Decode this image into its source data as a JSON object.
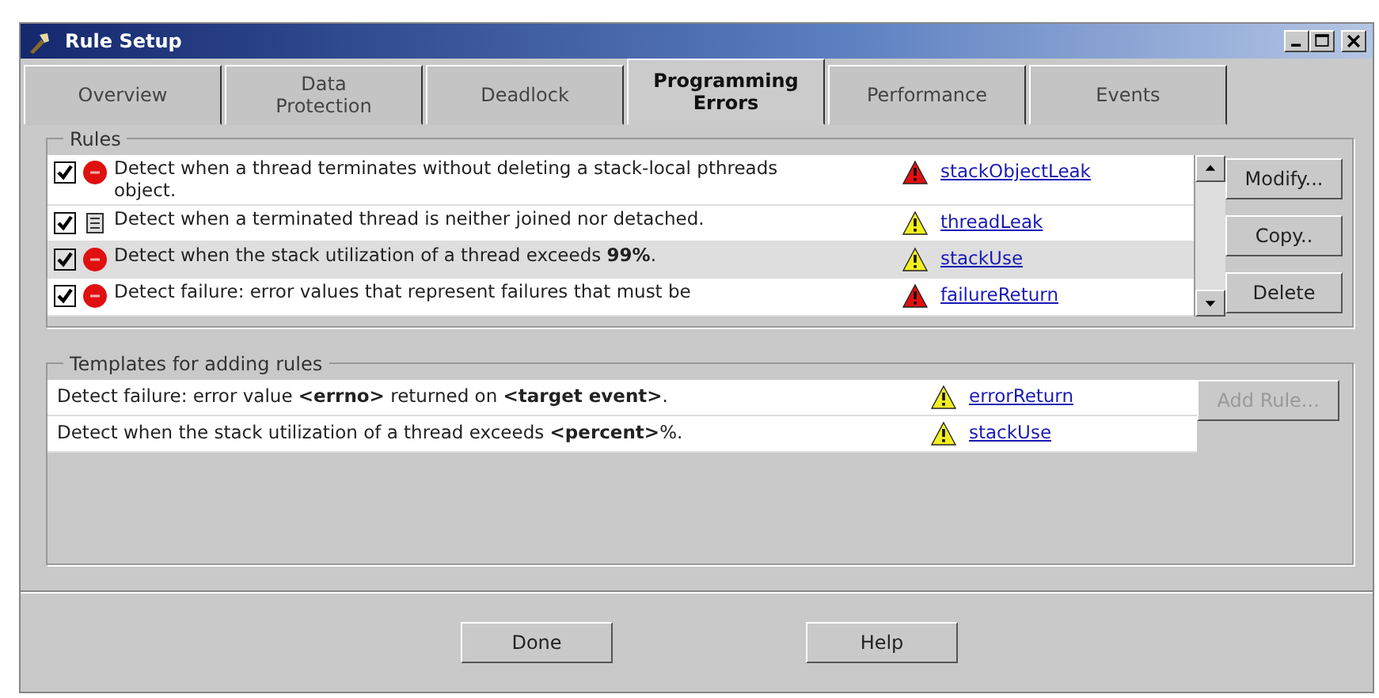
{
  "window": {
    "title": "Rule Setup"
  },
  "tabs": [
    {
      "label": "Overview",
      "selected": false
    },
    {
      "label": "Data\nProtection",
      "selected": false
    },
    {
      "label": "Deadlock",
      "selected": false
    },
    {
      "label": "Programming\nErrors",
      "selected": true
    },
    {
      "label": "Performance",
      "selected": false
    },
    {
      "label": "Events",
      "selected": false
    }
  ],
  "rules": {
    "title": "Rules",
    "rows": [
      {
        "checked": true,
        "kind": "error",
        "text": "Detect when a thread terminates without deleting a stack-local pthreads object.",
        "link": "stackObjectLeak",
        "color": "#e01010",
        "selected": false
      },
      {
        "checked": true,
        "kind": "note",
        "text": "Detect when a terminated thread is neither joined nor detached.",
        "link": "threadLeak",
        "color": "#f2ee20",
        "selected": false
      },
      {
        "checked": true,
        "kind": "error",
        "text": "Detect when the stack utilization of a thread exceeds **99%**.",
        "link": "stackUse",
        "color": "#f2ee20",
        "selected": true
      },
      {
        "checked": true,
        "kind": "error",
        "text": "Detect failure: error values that represent failures that must be",
        "link": "failureReturn",
        "color": "#e01010",
        "selected": false
      }
    ],
    "buttons": [
      {
        "label": "Modify...",
        "disabled": false
      },
      {
        "label": "Copy..",
        "disabled": false
      },
      {
        "label": "Delete",
        "disabled": false
      }
    ]
  },
  "templates": {
    "title": "Templates for adding rules",
    "rows": [
      {
        "text": "Detect failure: error value **<errno>** returned on **<target event>**.",
        "link": "errorReturn",
        "color": "#f2ee20"
      },
      {
        "text": "Detect when the stack utilization of a thread exceeds **<percent>**%.",
        "link": "stackUse",
        "color": "#f2ee20"
      }
    ],
    "button": {
      "label": "Add Rule...",
      "disabled": true
    }
  },
  "footer_buttons": [
    "Done",
    "Help"
  ]
}
